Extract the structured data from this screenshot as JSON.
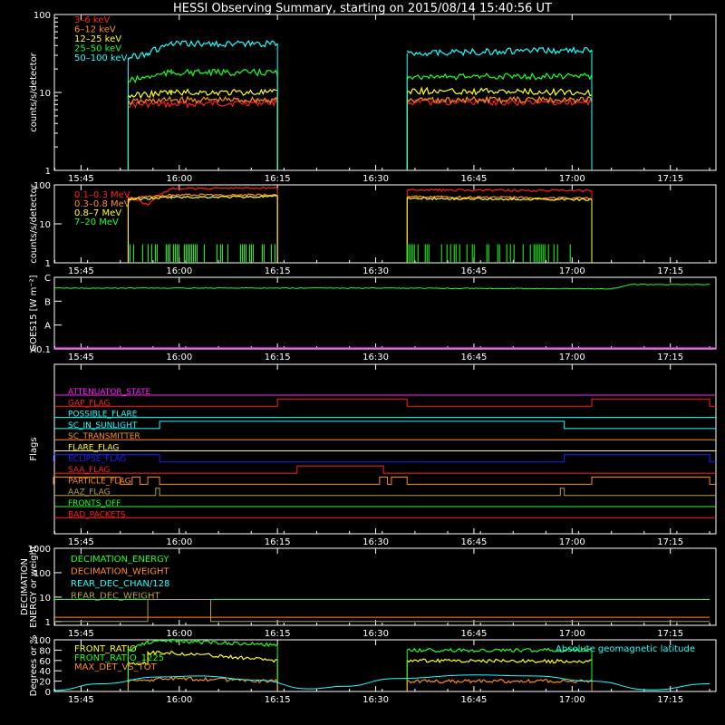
{
  "title": "HESSI Observing Summary, starting on 2015/08/14 15:40:56 UT",
  "x_ticks": [
    "15:45",
    "16:00",
    "16:15",
    "16:30",
    "16:45",
    "17:00",
    "17:15"
  ],
  "colors": {
    "red": "#ff2020",
    "orange": "#ff8c20",
    "yellow": "#ffff20",
    "green": "#20ff20",
    "cyan": "#20ffff",
    "magenta": "#ff20ff",
    "blue": "#2020ff",
    "olive": "#b4a040"
  },
  "chart_data": [
    {
      "type": "line",
      "name": "light-curves",
      "ylabel": "counts/s/detector",
      "y_ticks": [
        "1",
        "10",
        "100"
      ],
      "scale": "log",
      "ylim": [
        1,
        100
      ],
      "legend": [
        "3–6 keV",
        "6–12 keV",
        "12–25 keV",
        "25–50 keV",
        "50–100 keV"
      ],
      "series": [
        {
          "name": "3–6 keV",
          "color": "red",
          "segments": [
            [
              [
                15.87,
                7
              ],
              [
                15.98,
                7
              ],
              [
                16.25,
                7.5
              ]
            ],
            [
              [
                16.58,
                7.5
              ],
              [
                17.05,
                7.5
              ]
            ]
          ]
        },
        {
          "name": "6–12 keV",
          "color": "orange",
          "segments": [
            [
              [
                15.87,
                7.5
              ],
              [
                15.98,
                8
              ],
              [
                16.25,
                8
              ]
            ],
            [
              [
                16.58,
                8
              ],
              [
                17.05,
                8
              ]
            ]
          ]
        },
        {
          "name": "12–25 keV",
          "color": "yellow",
          "segments": [
            [
              [
                15.87,
                9
              ],
              [
                15.98,
                10
              ],
              [
                16.25,
                10
              ]
            ],
            [
              [
                16.58,
                10.5
              ],
              [
                17.05,
                10
              ]
            ]
          ]
        },
        {
          "name": "25–50 keV",
          "color": "green",
          "segments": [
            [
              [
                15.87,
                14
              ],
              [
                15.98,
                18
              ],
              [
                16.25,
                18
              ]
            ],
            [
              [
                16.58,
                16
              ],
              [
                17.05,
                16
              ]
            ]
          ]
        },
        {
          "name": "50–100 keV",
          "color": "cyan",
          "segments": [
            [
              [
                15.87,
                28
              ],
              [
                15.92,
                32
              ],
              [
                15.98,
                42
              ],
              [
                16.25,
                42
              ]
            ],
            [
              [
                16.58,
                32
              ],
              [
                17.05,
                35
              ]
            ]
          ]
        }
      ]
    },
    {
      "type": "line",
      "name": "gamma-curves",
      "ylabel": "counts/s/detector",
      "y_ticks": [
        "1",
        "10",
        "100"
      ],
      "scale": "log",
      "ylim": [
        1,
        100
      ],
      "legend": [
        "0.1–0.3 MeV",
        "0.3–0.8 MeV",
        "0.8–7 MeV",
        "7–20 MeV"
      ],
      "series": [
        {
          "name": "0.1–0.3 MeV",
          "color": "red",
          "segments": [
            [
              [
                15.87,
                50
              ],
              [
                15.92,
                30
              ],
              [
                15.98,
                80
              ],
              [
                16.25,
                85
              ]
            ],
            [
              [
                16.58,
                75
              ],
              [
                17.05,
                70
              ]
            ]
          ]
        },
        {
          "name": "0.3–0.8 MeV",
          "color": "orange",
          "segments": [
            [
              [
                15.87,
                45
              ],
              [
                15.98,
                55
              ],
              [
                16.25,
                55
              ]
            ],
            [
              [
                16.58,
                50
              ],
              [
                17.05,
                45
              ]
            ]
          ]
        },
        {
          "name": "0.8–7 MeV",
          "color": "yellow",
          "segments": [
            [
              [
                15.87,
                42
              ],
              [
                15.98,
                48
              ],
              [
                16.25,
                50
              ]
            ],
            [
              [
                16.58,
                45
              ],
              [
                17.05,
                42
              ]
            ]
          ]
        },
        {
          "name": "7–20 MeV",
          "color": "green",
          "segments": [
            [
              [
                15.87,
                1.5
              ],
              [
                16.25,
                1.5
              ]
            ],
            [
              [
                16.58,
                1.5
              ],
              [
                17.05,
                1.5
              ]
            ]
          ]
        }
      ]
    },
    {
      "type": "line",
      "name": "goes",
      "ylabel": "GOES15 [W m⁻²]",
      "y_ticks": [
        "A0.1",
        "A",
        "B",
        "C"
      ],
      "series": [
        {
          "name": "",
          "color": "green",
          "values": [
            [
              15.68,
              0.85
            ],
            [
              16.5,
              0.85
            ],
            [
              17.1,
              0.84
            ],
            [
              17.15,
              0.9
            ],
            [
              17.35,
              0.9
            ]
          ]
        }
      ]
    },
    {
      "type": "line",
      "name": "flags",
      "ylabel": "Flags",
      "flags": [
        {
          "name": "ATTENUATOR_STATE",
          "color": "magenta",
          "high": []
        },
        {
          "name": "GAP_FLAG",
          "color": "red",
          "high": [
            [
              16.25,
              16.58
            ],
            [
              17.05,
              17.35
            ]
          ]
        },
        {
          "name": "POSSIBLE_FLARE",
          "color": "cyan",
          "high": []
        },
        {
          "name": "SC_IN_SUNLIGHT",
          "color": "cyan",
          "high": [
            [
              15.95,
              16.98
            ]
          ]
        },
        {
          "name": "SC_TRANSMITTER",
          "color": "orange",
          "high": []
        },
        {
          "name": "FLARE_FLAG",
          "color": "yellow",
          "high": []
        },
        {
          "name": "ECLIPSE_FLAG",
          "color": "blue",
          "high": [
            [
              15.68,
              15.95
            ],
            [
              16.98,
              17.35
            ]
          ]
        },
        {
          "name": "SAA_FLAG",
          "color": "red",
          "high": [
            [
              16.3,
              16.52
            ]
          ]
        },
        {
          "name": "PARTICLE_FLAG",
          "color": "orange",
          "high": [
            [
              15.68,
              15.85
            ],
            [
              15.88,
              15.9
            ],
            [
              15.92,
              15.95
            ],
            [
              16.51,
              16.53
            ],
            [
              16.54,
              16.58
            ],
            [
              17.05,
              17.35
            ]
          ]
        },
        {
          "name": "AAZ_FLAG",
          "color": "olive",
          "high": [
            [
              15.94,
              15.95
            ],
            [
              16.97,
              16.98
            ]
          ]
        },
        {
          "name": "FRONTS_OFF",
          "color": "green",
          "high": []
        },
        {
          "name": "BAD_PACKETS",
          "color": "red",
          "high": []
        }
      ]
    },
    {
      "type": "line",
      "name": "decimation",
      "ylabel": "DECIMATION\nENERGY or weight",
      "y_ticks": [
        "1",
        "10",
        "100",
        "1000"
      ],
      "legend": [
        "DECIMATION_ENERGY",
        "DECIMATION_WEIGHT",
        "REAR_DEC_CHAN/128",
        "REAR_DEC_WEIGHT"
      ],
      "series": [
        {
          "name": "DECIMATION_ENERGY",
          "color": "green",
          "values": [
            [
              15.68,
              8
            ],
            [
              17.35,
              8
            ]
          ]
        },
        {
          "name": "DECIMATION_WEIGHT",
          "color": "orange",
          "values": [
            [
              15.68,
              1.5
            ],
            [
              17.35,
              1.5
            ]
          ]
        },
        {
          "name": "REAR_DEC_CHAN/128",
          "color": "cyan",
          "values": []
        },
        {
          "name": "REAR_DEC_WEIGHT",
          "color": "olive",
          "values": [
            [
              15.68,
              1
            ],
            [
              15.92,
              1
            ],
            [
              15.92,
              8
            ],
            [
              16.08,
              8
            ],
            [
              16.08,
              1
            ],
            [
              17.35,
              1
            ]
          ]
        }
      ]
    },
    {
      "type": "line",
      "name": "ratios",
      "ylabel": "Degrees or %",
      "y_ticks": [
        "0",
        "20",
        "40",
        "60",
        "80",
        "100"
      ],
      "legend": [
        "FRONT_RATIO",
        "FRONT_RATIO_1225",
        "MAX_DET_VS_TOT"
      ],
      "annotation": "Absolute geomagnetic latitude",
      "series": [
        {
          "name": "FRONT_RATIO",
          "color": "yellow",
          "segments": [
            [
              [
                15.87,
                55
              ],
              [
                15.92,
                55
              ],
              [
                15.92,
                75
              ],
              [
                15.98,
                75
              ],
              [
                16.25,
                60
              ]
            ],
            [
              [
                16.58,
                60
              ],
              [
                17.05,
                58
              ]
            ]
          ]
        },
        {
          "name": "FRONT_RATIO_1225",
          "color": "green",
          "segments": [
            [
              [
                15.87,
                80
              ],
              [
                15.92,
                95
              ],
              [
                15.98,
                98
              ],
              [
                16.25,
                90
              ]
            ],
            [
              [
                16.58,
                80
              ],
              [
                17.05,
                80
              ]
            ]
          ]
        },
        {
          "name": "MAX_DET_VS_TOT",
          "color": "orange",
          "segments": [
            [
              [
                15.87,
                20
              ],
              [
                15.98,
                25
              ],
              [
                16.25,
                20
              ]
            ],
            [
              [
                16.58,
                20
              ],
              [
                17.05,
                20
              ]
            ]
          ]
        },
        {
          "name": "Absolute geomagnetic latitude",
          "color": "cyan",
          "values": [
            [
              15.68,
              2
            ],
            [
              15.8,
              15
            ],
            [
              15.95,
              28
            ],
            [
              16.05,
              30
            ],
            [
              16.2,
              22
            ],
            [
              16.33,
              5
            ],
            [
              16.42,
              10
            ],
            [
              16.55,
              25
            ],
            [
              16.75,
              32
            ],
            [
              16.9,
              30
            ],
            [
              17.05,
              20
            ],
            [
              17.2,
              3
            ],
            [
              17.35,
              15
            ]
          ]
        }
      ]
    }
  ]
}
